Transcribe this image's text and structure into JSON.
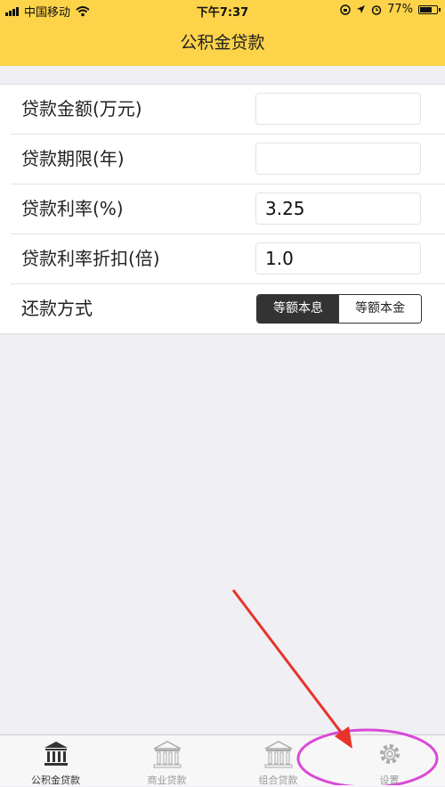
{
  "status_bar": {
    "carrier": "中国移动",
    "time": "下午7:37",
    "battery": "77%",
    "battery_level": 0.77
  },
  "nav": {
    "title": "公积金贷款"
  },
  "form": {
    "rows": [
      {
        "label": "贷款金额(万元)",
        "value": ""
      },
      {
        "label": "贷款期限(年)",
        "value": ""
      },
      {
        "label": "贷款利率(%)",
        "value": "3.25"
      },
      {
        "label": "贷款利率折扣(倍)",
        "value": "1.0"
      }
    ],
    "repayment": {
      "label": "还款方式",
      "options": [
        "等额本息",
        "等额本金"
      ],
      "selected": "等额本息"
    }
  },
  "tabs": [
    {
      "label": "公积金贷款",
      "icon": "bank-icon",
      "active": true
    },
    {
      "label": "商业贷款",
      "icon": "bank-icon",
      "active": false
    },
    {
      "label": "组合贷款",
      "icon": "bank-icon",
      "active": false
    },
    {
      "label": "设置",
      "icon": "gear-icon",
      "active": false
    }
  ],
  "colors": {
    "accent": "#fdd34a",
    "annotation": "#e8332c",
    "highlight_circle": "#d94ad6"
  }
}
